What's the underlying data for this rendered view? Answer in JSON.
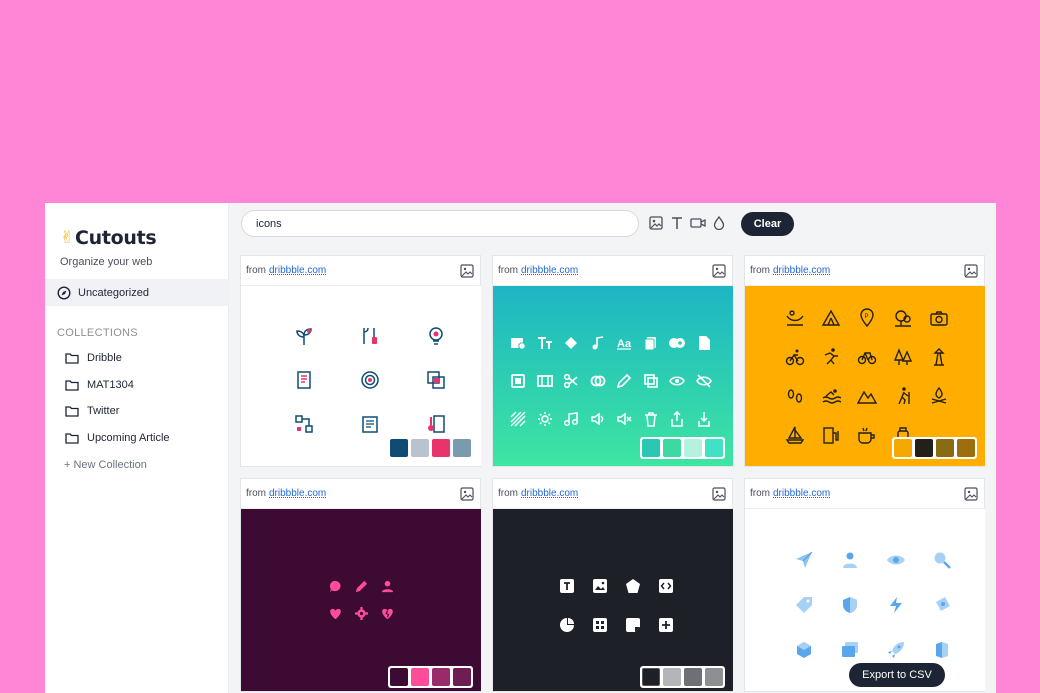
{
  "app": {
    "name": "Cutouts",
    "tagline": "Organize your web"
  },
  "sidebar": {
    "uncategorized": "Uncategorized",
    "collections_title": "COLLECTIONS",
    "collections": [
      {
        "label": "Dribble"
      },
      {
        "label": "MAT1304"
      },
      {
        "label": "Twitter"
      },
      {
        "label": "Upcoming Article"
      }
    ],
    "new_collection": "+ New Collection"
  },
  "toolbar": {
    "search_value": "icons",
    "clear_label": "Clear",
    "filters": [
      "image-icon",
      "text-icon",
      "video-icon",
      "color-drop-icon"
    ]
  },
  "cards": [
    {
      "from": "from",
      "domain": "dribbble.com",
      "palette": [
        "#0f4c75",
        "#b9c3d0",
        "#e8336b",
        "#7a9aad"
      ],
      "bg": "#ffffff"
    },
    {
      "from": "from",
      "domain": "dribbble.com",
      "palette": [
        "#2ac8b2",
        "#3dd9a0",
        "#b6f1de",
        "#3fe2c4"
      ],
      "bg": "gradient-teal"
    },
    {
      "from": "from",
      "domain": "dribbble.com",
      "palette": [
        "#f5a800",
        "#231f1a",
        "#8a6a12",
        "#9c6f0c"
      ],
      "bg": "#ffae00"
    },
    {
      "from": "from",
      "domain": "dribbble.com",
      "palette": [
        "#3d0a33",
        "#ff4d9a",
        "#9a2b6a",
        "#6e1e52"
      ],
      "bg": "#3d0a33"
    },
    {
      "from": "from",
      "domain": "dribbble.com",
      "palette": [
        "#1d2026",
        "#b3b5b9",
        "#6e7075",
        "#8d8f93"
      ],
      "bg": "#1e2027"
    },
    {
      "from": "from",
      "domain": "dribbble.com",
      "palette": [],
      "bg": "#ffffff"
    }
  ],
  "footer": {
    "export_label": "Export to CSV"
  }
}
